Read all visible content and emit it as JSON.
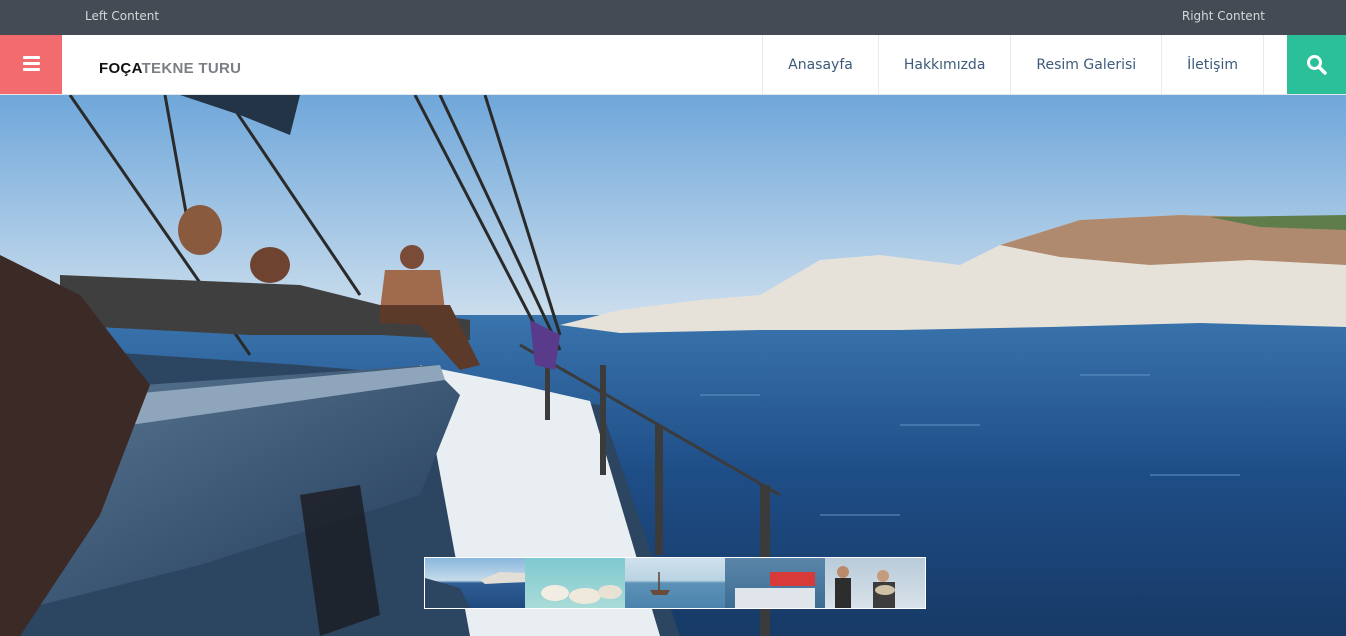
{
  "topbar": {
    "left_text": "Left Content",
    "right_text": "Right Content"
  },
  "header": {
    "logo_part1": "FOÇA",
    "logo_part2": "TEKNE TURU",
    "menu_icon": "bars-icon",
    "search_icon": "search-icon",
    "nav": [
      {
        "label": "Anasayfa"
      },
      {
        "label": "Hakkımızda"
      },
      {
        "label": "Resim Galerisi"
      },
      {
        "label": "İletişim"
      }
    ]
  },
  "colors": {
    "topbar_bg": "#454b54",
    "menu_button_bg": "#f26b6e",
    "search_button_bg": "#2bbf9a",
    "nav_text": "#3d5a7a"
  },
  "gallery": {
    "thumbnail_count": 5
  }
}
